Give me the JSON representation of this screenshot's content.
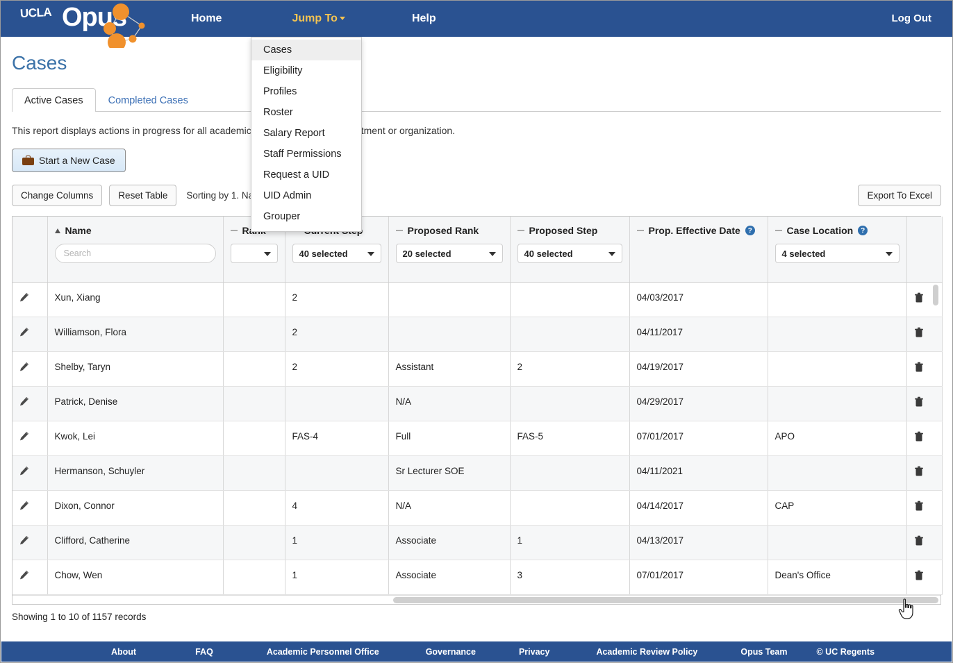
{
  "brand": {
    "ucla": "UCLA",
    "opus": "Opus"
  },
  "topnav": {
    "home": "Home",
    "jump_to": "Jump To",
    "help": "Help",
    "logout": "Log Out"
  },
  "dropdown": {
    "items": [
      {
        "label": "Cases",
        "active": true
      },
      {
        "label": "Eligibility",
        "active": false
      },
      {
        "label": "Profiles",
        "active": false
      },
      {
        "label": "Roster",
        "active": false
      },
      {
        "label": "Salary Report",
        "active": false
      },
      {
        "label": "Staff Permissions",
        "active": false
      },
      {
        "label": "Request a UID",
        "active": false
      },
      {
        "label": "UID Admin",
        "active": false
      },
      {
        "label": "Grouper",
        "active": false
      }
    ]
  },
  "page": {
    "title": "Cases",
    "tabs": [
      {
        "label": "Active Cases",
        "selected": true
      },
      {
        "label": "Completed Cases",
        "selected": false
      }
    ],
    "description": "This report displays actions in progress for all academic appointees in your department or organization.",
    "start_new_case": "Start a New Case",
    "change_columns": "Change Columns",
    "reset_table": "Reset Table",
    "sorting_by": "Sorting by 1. Name",
    "export_to_excel": "Export To Excel",
    "records": "Showing 1 to 10 of 1157 records"
  },
  "table": {
    "columns": [
      {
        "label": "",
        "kind": "edit"
      },
      {
        "label": "Name",
        "kind": "search",
        "sort": "asc",
        "placeholder": "Search"
      },
      {
        "label": "Rank",
        "kind": "select",
        "value": "",
        "marker": "dash"
      },
      {
        "label": "Current Step",
        "kind": "select",
        "value": "40 selected",
        "marker": "dash"
      },
      {
        "label": "Proposed Rank",
        "kind": "select",
        "value": "20 selected",
        "marker": "dash"
      },
      {
        "label": "Proposed Step",
        "kind": "select",
        "value": "40 selected",
        "marker": "dash"
      },
      {
        "label": "Prop. Effective Date",
        "kind": "plain",
        "marker": "dash",
        "help": "?"
      },
      {
        "label": "Case Location",
        "kind": "select",
        "value": "4 selected",
        "marker": "dash",
        "help": "?"
      },
      {
        "label": "",
        "kind": "delete"
      }
    ],
    "rows": [
      {
        "name": "Xun, Xiang",
        "rank": "",
        "current_step": "2",
        "proposed_rank": "",
        "proposed_step": "",
        "effective_date": "04/03/2017",
        "case_location": ""
      },
      {
        "name": "Williamson, Flora",
        "rank": "",
        "current_step": "2",
        "proposed_rank": "",
        "proposed_step": "",
        "effective_date": "04/11/2017",
        "case_location": ""
      },
      {
        "name": "Shelby, Taryn",
        "rank": "",
        "current_step": "2",
        "proposed_rank": "Assistant",
        "proposed_step": "2",
        "effective_date": "04/19/2017",
        "case_location": ""
      },
      {
        "name": "Patrick, Denise",
        "rank": "",
        "current_step": "",
        "proposed_rank": "N/A",
        "proposed_step": "",
        "effective_date": "04/29/2017",
        "case_location": ""
      },
      {
        "name": "Kwok, Lei",
        "rank": "",
        "current_step": "FAS-4",
        "proposed_rank": "Full",
        "proposed_step": "FAS-5",
        "effective_date": "07/01/2017",
        "case_location": "APO"
      },
      {
        "name": "Hermanson, Schuyler",
        "rank": "",
        "current_step": "",
        "proposed_rank": "Sr Lecturer SOE",
        "proposed_step": "",
        "effective_date": "04/11/2021",
        "case_location": ""
      },
      {
        "name": "Dixon, Connor",
        "rank": "",
        "current_step": "4",
        "proposed_rank": "N/A",
        "proposed_step": "",
        "effective_date": "04/14/2017",
        "case_location": "CAP"
      },
      {
        "name": "Clifford, Catherine",
        "rank": "",
        "current_step": "1",
        "proposed_rank": "Associate",
        "proposed_step": "1",
        "effective_date": "04/13/2017",
        "case_location": ""
      },
      {
        "name": "Chow, Wen",
        "rank": "",
        "current_step": "1",
        "proposed_rank": "Associate",
        "proposed_step": "3",
        "effective_date": "07/01/2017",
        "case_location": "Dean's Office"
      }
    ]
  },
  "footer": {
    "links": [
      "About",
      "FAQ",
      "Academic Personnel Office",
      "Governance",
      "Privacy",
      "Academic Review Policy",
      "Opus Team",
      "© UC Regents"
    ]
  },
  "colors": {
    "brand_blue": "#2a5291",
    "accent_orange": "#f0912d",
    "jump_to_yellow": "#f5c451",
    "title_blue": "#3b72a8",
    "link_blue": "#3b6fb5"
  }
}
